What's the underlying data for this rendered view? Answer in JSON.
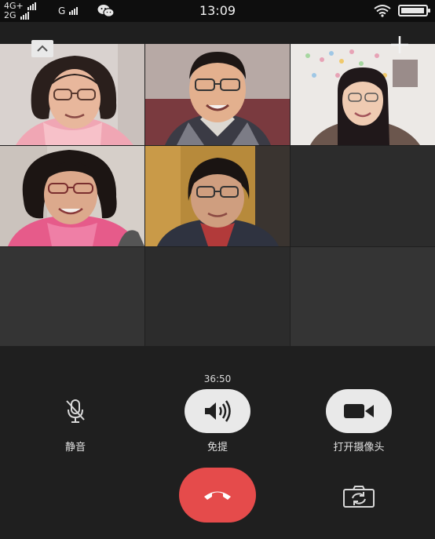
{
  "status_bar": {
    "network_line1": "4G+",
    "network_line2": "2G",
    "network_g": "G",
    "time": "13:09",
    "battery_level": 0.95
  },
  "call": {
    "timer": "36:50",
    "controls": {
      "mute_label": "静音",
      "speaker_label": "免提",
      "camera_label": "打开摄像头"
    }
  },
  "icons": {
    "collapse": "chevron-up-icon",
    "add": "plus-icon",
    "mute": "microphone-off-icon",
    "speaker": "speaker-icon",
    "camera": "video-camera-icon",
    "hangup": "phone-hangup-icon",
    "switch_camera": "camera-switch-icon",
    "wechat": "wechat-icon",
    "wifi": "wifi-icon",
    "battery": "battery-icon"
  },
  "colors": {
    "background": "#1f1f1f",
    "hangup": "#e54b4b",
    "control_button": "#e9e9e9",
    "empty_tile": "#2c2c2c"
  },
  "participants": [
    {
      "id": "participant-1"
    },
    {
      "id": "participant-2"
    },
    {
      "id": "participant-3"
    },
    {
      "id": "participant-4"
    },
    {
      "id": "participant-5"
    }
  ]
}
